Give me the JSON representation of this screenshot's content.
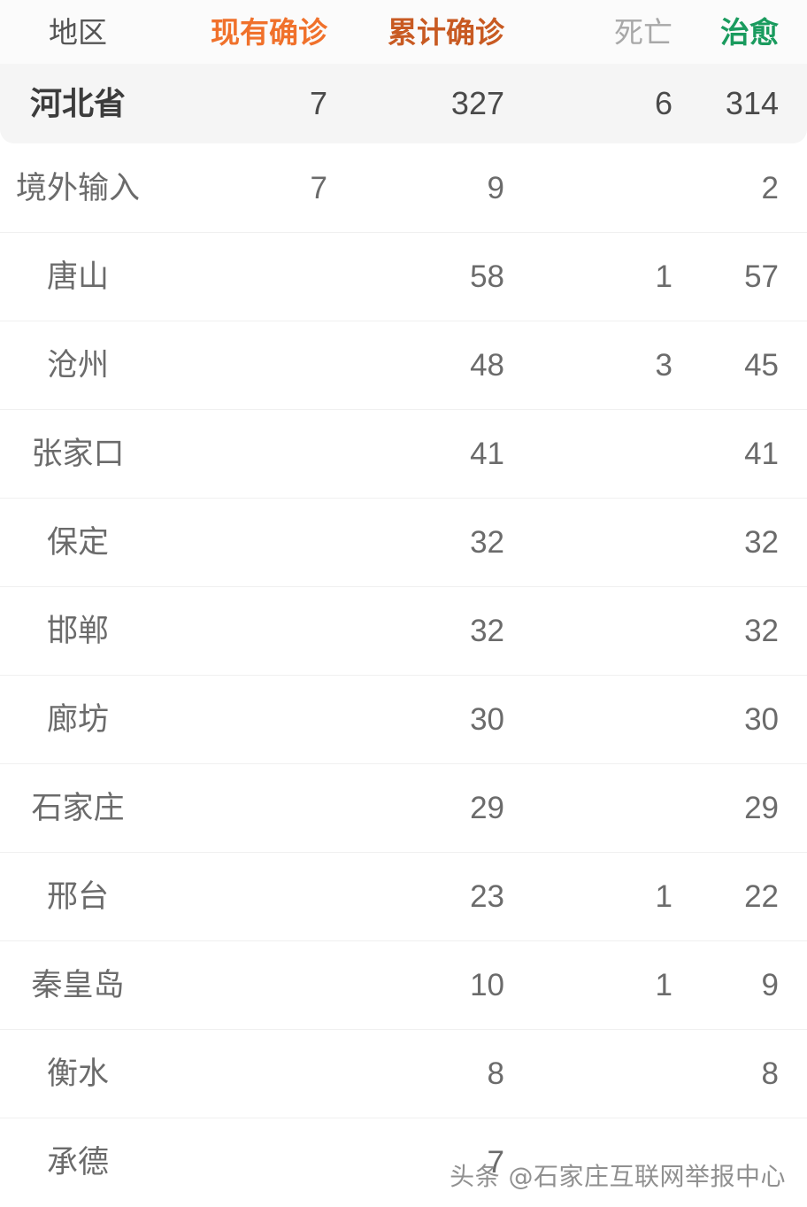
{
  "table": {
    "columns": [
      {
        "key": "region",
        "label": "地区",
        "color": "#555555"
      },
      {
        "key": "current",
        "label": "现有确诊",
        "color": "#f0712b"
      },
      {
        "key": "total",
        "label": "累计确诊",
        "color": "#c85a22"
      },
      {
        "key": "death",
        "label": "死亡",
        "color": "#a8a8a8"
      },
      {
        "key": "cure",
        "label": "治愈",
        "color": "#1a9b5e"
      }
    ],
    "summary_row": {
      "region": "河北省",
      "current": "7",
      "total": "327",
      "death": "6",
      "cure": "314"
    },
    "rows": [
      {
        "region": "境外输入",
        "current": "7",
        "total": "9",
        "death": "",
        "cure": "2"
      },
      {
        "region": "唐山",
        "current": "",
        "total": "58",
        "death": "1",
        "cure": "57"
      },
      {
        "region": "沧州",
        "current": "",
        "total": "48",
        "death": "3",
        "cure": "45"
      },
      {
        "region": "张家口",
        "current": "",
        "total": "41",
        "death": "",
        "cure": "41"
      },
      {
        "region": "保定",
        "current": "",
        "total": "32",
        "death": "",
        "cure": "32"
      },
      {
        "region": "邯郸",
        "current": "",
        "total": "32",
        "death": "",
        "cure": "32"
      },
      {
        "region": "廊坊",
        "current": "",
        "total": "30",
        "death": "",
        "cure": "30"
      },
      {
        "region": "石家庄",
        "current": "",
        "total": "29",
        "death": "",
        "cure": "29"
      },
      {
        "region": "邢台",
        "current": "",
        "total": "23",
        "death": "1",
        "cure": "22"
      },
      {
        "region": "秦皇岛",
        "current": "",
        "total": "10",
        "death": "1",
        "cure": "9"
      },
      {
        "region": "衡水",
        "current": "",
        "total": "8",
        "death": "",
        "cure": "8"
      },
      {
        "region": "承德",
        "current": "",
        "total": "7",
        "death": "",
        "cure": ""
      }
    ]
  },
  "watermark": {
    "text": "头条 @石家庄互联网举报中心"
  }
}
